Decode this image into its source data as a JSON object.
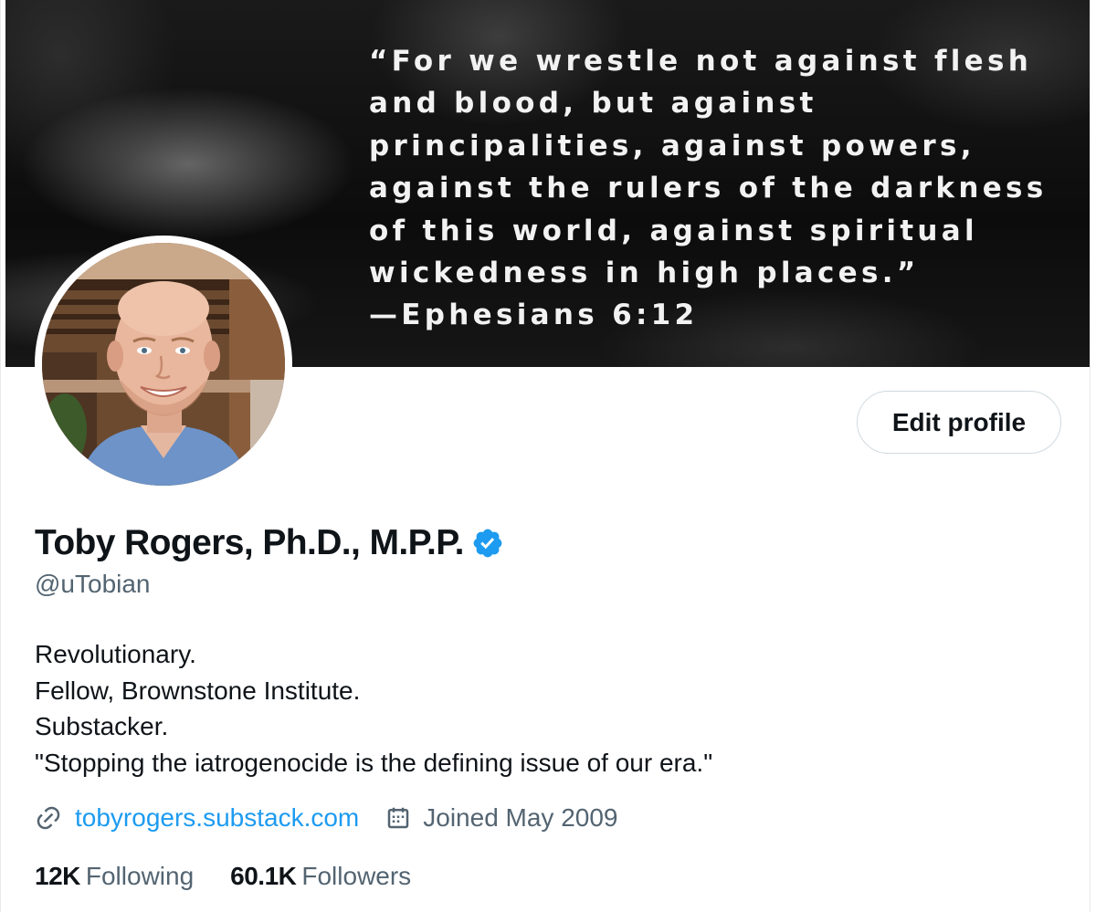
{
  "banner": {
    "quote_lines": [
      "“For we wrestle not against flesh",
      "and blood, but against",
      "principalities, against powers,",
      "against the rulers of the darkness",
      "of this world, against spiritual",
      "wickedness in high places.”",
      "—Ephesians 6:12"
    ]
  },
  "profile": {
    "edit_label": "Edit profile",
    "name": "Toby Rogers, Ph.D., M.P.P.",
    "verified_icon": "verified-badge-icon",
    "handle": "@uTobian",
    "bio_lines": [
      "Revolutionary.",
      "Fellow, Brownstone Institute.",
      "Substacker.",
      "\"Stopping the iatrogenocide is the defining issue of our era.\""
    ],
    "link_icon": "link-icon",
    "link": "tobyrogers.substack.com",
    "calendar_icon": "calendar-icon",
    "joined": "Joined May 2009"
  },
  "stats": {
    "following_count": "12K",
    "following_label": "Following",
    "followers_count": "60.1K",
    "followers_label": "Followers"
  },
  "colors": {
    "accent": "#1d9bf0",
    "secondary_text": "#536471",
    "primary_text": "#0f1419",
    "border": "#cfd9de"
  }
}
